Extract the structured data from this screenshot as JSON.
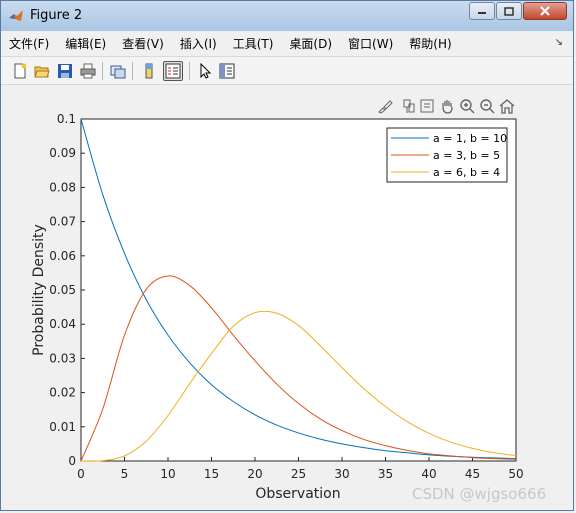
{
  "window": {
    "title": "Figure 2"
  },
  "menu": [
    "文件(F)",
    "编辑(E)",
    "查看(V)",
    "插入(I)",
    "工具(T)",
    "桌面(D)",
    "窗口(W)",
    "帮助(H)"
  ],
  "colors": {
    "series1": "#0072bd",
    "series2": "#d95319",
    "series3": "#edb120",
    "titlebar": "#b8d0ea"
  },
  "toolbar_icons": [
    "new-figure-icon",
    "open-file-icon",
    "save-icon",
    "print-icon",
    "link-plot-icon",
    "colorbar-icon",
    "legend-icon",
    "pointer-icon",
    "property-editor-icon"
  ],
  "axes_toolbar_icons": [
    "brush-icon",
    "data-tips-icon",
    "pan-icon",
    "zoom-in-icon",
    "zoom-out-icon",
    "home-icon"
  ],
  "watermark": "CSDN @wjgso666",
  "chart_data": {
    "type": "line",
    "title": "",
    "xlabel": "Observation",
    "ylabel": "Probability Density",
    "xlim": [
      0,
      50
    ],
    "ylim": [
      0,
      0.1
    ],
    "xticks": [
      "0",
      "5",
      "10",
      "15",
      "20",
      "25",
      "30",
      "35",
      "40",
      "45",
      "50"
    ],
    "yticks": [
      "0",
      "0.01",
      "0.02",
      "0.03",
      "0.04",
      "0.05",
      "0.06",
      "0.07",
      "0.08",
      "0.09",
      "0.1"
    ],
    "grid": false,
    "legend_position": "top-right",
    "x": [
      0,
      2.5,
      5,
      7.5,
      10,
      12.5,
      15,
      17.5,
      20,
      22.5,
      25,
      27.5,
      30,
      32.5,
      35,
      37.5,
      40,
      42.5,
      45,
      47.5,
      50
    ],
    "series": [
      {
        "name": "a = 1, b = 10",
        "values": [
          0.1,
          0.0779,
          0.0607,
          0.0472,
          0.0368,
          0.0287,
          0.0223,
          0.0174,
          0.0135,
          0.0105,
          0.0082,
          0.0064,
          0.005,
          0.0039,
          0.003,
          0.0024,
          0.0018,
          0.0014,
          0.0011,
          0.0009,
          0.0007
        ]
      },
      {
        "name": "a = 3, b = 5",
        "values": [
          0,
          0.0152,
          0.0368,
          0.0502,
          0.0541,
          0.0513,
          0.0448,
          0.0368,
          0.0293,
          0.0225,
          0.0168,
          0.0123,
          0.0089,
          0.0063,
          0.0045,
          0.0031,
          0.0021,
          0.0015,
          0.001,
          0.0007,
          0.0005
        ]
      },
      {
        "name": "a = 6, b = 4",
        "values": [
          0,
          0.0001,
          0.0015,
          0.0058,
          0.0133,
          0.0226,
          0.0314,
          0.0394,
          0.0434,
          0.0432,
          0.0396,
          0.0337,
          0.0273,
          0.0212,
          0.0159,
          0.0115,
          0.0081,
          0.0055,
          0.0037,
          0.0024,
          0.0016
        ]
      }
    ]
  }
}
